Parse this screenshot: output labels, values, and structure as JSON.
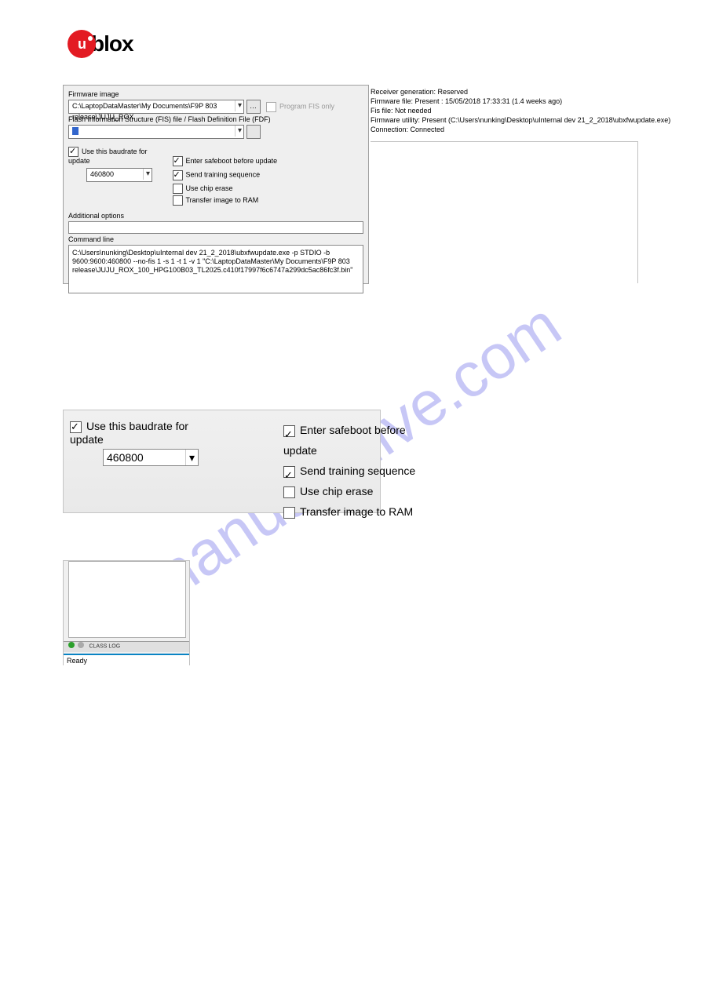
{
  "logo": {
    "text": "blox",
    "mark_letter": "u"
  },
  "fw": {
    "section_label": "Firmware image",
    "path": "C:\\LaptopDataMaster\\My Documents\\F9P 803 release\\JUJU_ROX",
    "program_fis_label": "Program FIS only",
    "fis_label": "Flash Information Structure (FIS) file / Flash Definition File (FDF)",
    "fis_value": "",
    "use_baud_label": "Use this baudrate for update",
    "baud_value": "460800",
    "enter_safeboot": "Enter safeboot before update",
    "send_training": "Send training sequence",
    "chip_erase": "Use chip erase",
    "transfer_ram": "Transfer image to RAM",
    "additional_label": "Additional options",
    "cmd_label": "Command line",
    "cmd_text": "C:\\Users\\nunking\\Desktop\\uInternal dev 21_2_2018\\ubxfwupdate.exe -p STDIO -b 9600:9600:460800 --no-fis 1 -s 1 -t 1 -v 1 \"C:\\LaptopDataMaster\\My Documents\\F9P 803 release\\JUJU_ROX_100_HPG100B03_TL2025.c410f17997f6c6747a299dc5ac86fc3f.bin\""
  },
  "status": {
    "recv_gen": "Receiver generation: Reserved",
    "fw_file": "Firmware file: Present : 15/05/2018 17:33:31 (1.4 weeks ago)",
    "fis_file": "Fis file: Not needed",
    "fw_utility": "Firmware utility: Present (C:\\Users\\nunking\\Desktop\\uInternal dev 21_2_2018\\ubxfwupdate.exe)",
    "conn": "Connection: Connected"
  },
  "detail": {
    "use_baud": "Use this baudrate for update",
    "baud": "460800",
    "enter_safeboot": "Enter safeboot before update",
    "send_training": "Send training sequence",
    "chip_erase": "Use chip erase",
    "transfer_ram": "Transfer image to RAM"
  },
  "footer": {
    "cls": "CLASS LOG",
    "ready": "Ready"
  },
  "watermark": "manualshive.com"
}
